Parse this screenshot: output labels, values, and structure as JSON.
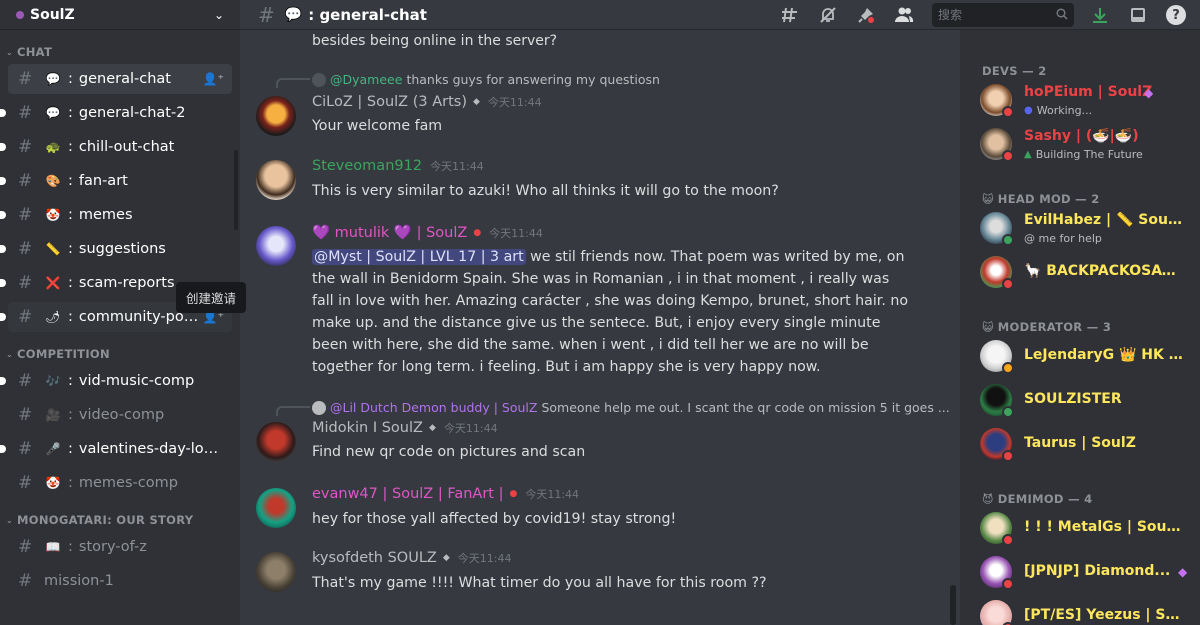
{
  "server": {
    "name": "SoulZ"
  },
  "sidebar": {
    "categories": [
      {
        "label": "CHAT"
      },
      {
        "label": "COMPETITION"
      },
      {
        "label": "MONOGATARI: OUR STORY"
      }
    ],
    "channels": [
      {
        "name": "general-chat",
        "emoji": "💬"
      },
      {
        "name": "general-chat-2",
        "emoji": "💬"
      },
      {
        "name": "chill-out-chat",
        "emoji": "🐢"
      },
      {
        "name": "fan-art",
        "emoji": "🎨"
      },
      {
        "name": "memes",
        "emoji": "🤡"
      },
      {
        "name": "suggestions",
        "emoji": "📏"
      },
      {
        "name": "scam-reports",
        "emoji": "❌"
      },
      {
        "name": "community-posts",
        "emoji": "🌶"
      },
      {
        "name": "vid-music-comp",
        "emoji": "🎶"
      },
      {
        "name": "video-comp",
        "emoji": "🎥"
      },
      {
        "name": "valentines-day-love...",
        "emoji": "🎤"
      },
      {
        "name": "memes-comp",
        "emoji": "🤡"
      },
      {
        "name": "story-of-z",
        "emoji": "📖"
      },
      {
        "name": "mission-1",
        "emoji": ""
      }
    ],
    "tooltip": "创建邀请"
  },
  "topbar": {
    "channel_emoji": "💬",
    "channel_title": "general-chat",
    "search_placeholder": "搜索"
  },
  "messages": {
    "cut_text": "besides being online in the server?",
    "items": [
      {
        "reply_author": "@Dyameee",
        "reply_text": "thanks guys for answering my questiosn",
        "author": "CiLoZ | SoulZ (3 Arts)",
        "timestamp": "今天11:44",
        "text": "Your welcome fam"
      },
      {
        "author": "Steveoman912",
        "timestamp": "今天11:44",
        "text": "This is very similar to azuki! Who all thinks it will go to the moon?"
      },
      {
        "author": "💜 mutulik 💜 | SoulZ",
        "timestamp": "今天11:44",
        "mention": "@Myst | SoulZ | LVL 17 | 3 art",
        "text": " we stil friends now. That poem was writed by me, on the wall in Benidorm Spain. She was in Romanian , i in that moment , i really was fall in love with her. Amazing carácter , she was doing Kempo, brunet, short hair. no make up. and the distance give us the sentece. But, i enjoy every single minute been with here, she did the same. when i went , i did tell her we are no will be together for long term. i feeling. But i am happy she is very happy now."
      },
      {
        "reply_author": "@Lil Dutch Demon buddy | SoulZ",
        "reply_text": "Someone help me out. I scant the qr code on mission 5 it goes ...",
        "author": "Midokin I SoulZ",
        "timestamp": "今天11:44",
        "text": "Find new qr code on pictures and scan"
      },
      {
        "author": "evanw47 | SoulZ | FanArt |",
        "timestamp": "今天11:44",
        "text": "hey for those yall affected by covid19! stay strong!"
      },
      {
        "author": "kysofdeth SOULZ",
        "timestamp": "今天11:44",
        "text": "That's my game !!!! What timer do you all have for this room ??"
      }
    ]
  },
  "members": {
    "groups": [
      {
        "label": "DEVS — 2",
        "icon": ""
      },
      {
        "label": "HEAD MOD — 2",
        "icon": "😺"
      },
      {
        "label": "MODERATOR — 3",
        "icon": "😺"
      },
      {
        "label": "DEMIMOD — 4",
        "icon": "😈"
      }
    ],
    "list": [
      {
        "name": "hoPEium | SoulZ",
        "sub": "Working..."
      },
      {
        "name": "Sashy | (🍜|🍜)",
        "sub": "Building The Future"
      },
      {
        "name": "EvilHabez | 📏 SoulZ ...",
        "sub": "@ me for help"
      },
      {
        "name": "🦙 BACKPACKOSAUR..."
      },
      {
        "name": "LeJendaryG 👑 HK | So..."
      },
      {
        "name": "SOULZISTER"
      },
      {
        "name": "Taurus | SoulZ"
      },
      {
        "name": "! ! ! MetalGs | Soulz | A..."
      },
      {
        "name": "[JPNJP] Diamond..."
      },
      {
        "name": "[PT/ES] Yeezus | SoulZ"
      }
    ]
  },
  "colors": {
    "dev_name": "#ed4245",
    "mod_name": "#fee75c",
    "author_green": "#3ba55d",
    "author_pink": "#e056c6",
    "author_gray": "#b9bbbe",
    "reply_green": "#43b581",
    "reply_purple": "#b072f0"
  }
}
